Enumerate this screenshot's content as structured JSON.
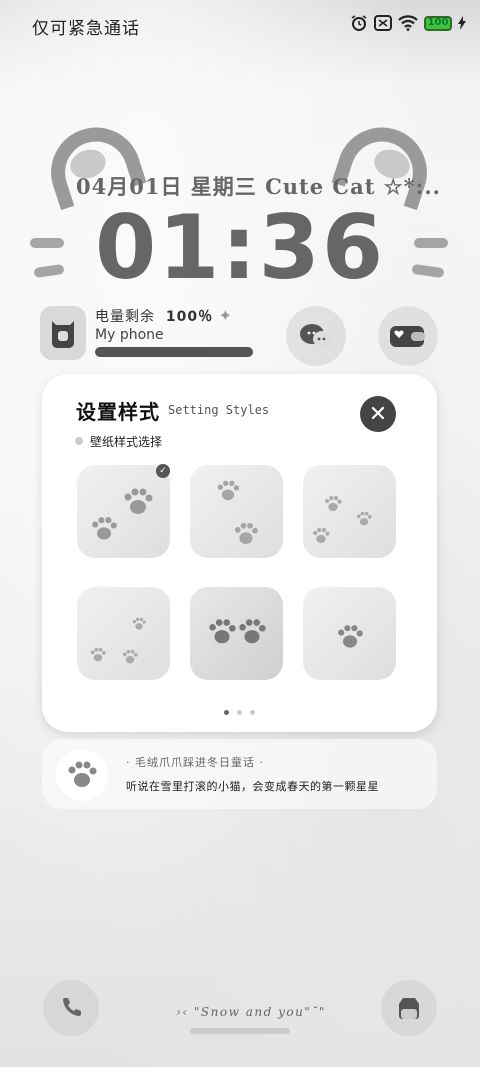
{
  "status_bar": {
    "left_text": "仅可紧急通话",
    "battery_level": "100"
  },
  "lock": {
    "date": "04月01日 星期三 Cute Cat ☆*:..",
    "time": "01:36"
  },
  "battery_widget": {
    "label": "电量剩余",
    "percent": "100％",
    "sparkle": "✦",
    "device_name": "My phone",
    "level": 1.0
  },
  "settings_card": {
    "title": "设置样式",
    "subtitle": "Setting Styles",
    "close_label": "✕",
    "section_label": "壁纸样式选择",
    "selected_index": 0,
    "check_glyph": "✓",
    "page_dots": 3,
    "current_page": 0
  },
  "quote": {
    "title": "· 毛绒爪爪踩进冬日童话 ·",
    "text": "听说在雪里打滚的小猫，会变成春天的第一颗星星"
  },
  "bottom": {
    "caption": "›‹ \"Snow and you\"˘\""
  },
  "colors": {
    "accent_dark": "#444444",
    "battery_fill": "#3cc43a"
  }
}
